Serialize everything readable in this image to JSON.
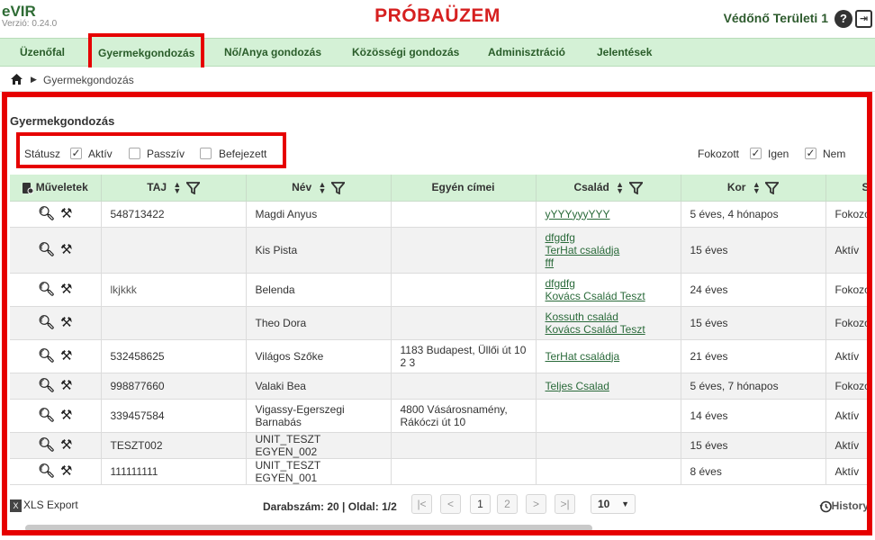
{
  "app": {
    "name": "eVIR",
    "version": "Verzió: 0.24.0",
    "environment": "PRÓBAÜZEM",
    "user": "Védőnő Területi 1"
  },
  "nav": {
    "items": [
      {
        "label": "Üzenőfal",
        "active": false
      },
      {
        "label": "Gyermekgondozás",
        "active": true
      },
      {
        "label": "Nő/Anya gondozás",
        "active": false
      },
      {
        "label": "Közösségi gondozás",
        "active": false
      },
      {
        "label": "Adminisztráció",
        "active": false
      },
      {
        "label": "Jelentések",
        "active": false
      }
    ]
  },
  "breadcrumb": {
    "current": "Gyermekgondozás"
  },
  "page": {
    "title": "Gyermekgondozás"
  },
  "filters": {
    "status_label": "Státusz",
    "status_options": [
      {
        "label": "Aktív",
        "checked": true
      },
      {
        "label": "Passzív",
        "checked": false
      },
      {
        "label": "Befejezett",
        "checked": false
      }
    ],
    "fokozott_label": "Fokozott",
    "fokozott_options": [
      {
        "label": "Igen",
        "checked": true
      },
      {
        "label": "Nem",
        "checked": true
      }
    ]
  },
  "table": {
    "columns": {
      "actions": "Műveletek",
      "taj": "TAJ",
      "nev": "Név",
      "cimek": "Egyén címei",
      "csalad": "Család",
      "kor": "Kor",
      "status": "S"
    },
    "rows": [
      {
        "taj": "548713422",
        "nev": "Magdi Anyus",
        "cim": "",
        "csalad": [
          "yYYYyyyYYY"
        ],
        "kor": "5 éves, 4 hónapos",
        "status": "Fokozo"
      },
      {
        "taj": "",
        "nev": "Kis Pista",
        "cim": "",
        "csalad": [
          "dfgdfg",
          "TerHat családja",
          "fff"
        ],
        "kor": "15 éves",
        "status": "Aktív"
      },
      {
        "taj": "lkjkkk",
        "nev": "Belenda",
        "cim": "",
        "csalad": [
          "dfgdfg",
          "Kovács Család Teszt"
        ],
        "kor": "24 éves",
        "status": "Fokozo"
      },
      {
        "taj": "",
        "nev": "Theo Dora",
        "cim": "",
        "csalad": [
          "Kossuth család",
          "Kovács Család Teszt"
        ],
        "kor": "15 éves",
        "status": "Fokozo"
      },
      {
        "taj": "532458625",
        "nev": "Világos Szőke",
        "cim": "1183 Budapest, Üllői út 10 2 3",
        "csalad": [
          "TerHat családja"
        ],
        "kor": "21 éves",
        "status": "Aktív"
      },
      {
        "taj": "998877660",
        "nev": "Valaki Bea",
        "cim": "",
        "csalad": [
          "Teljes Csalad"
        ],
        "kor": "5 éves, 7 hónapos",
        "status": "Fokozo"
      },
      {
        "taj": "339457584",
        "nev": "Vigassy-Egerszegi Barnabás",
        "cim": "4800 Vásárosnamény, Rákóczi út 10",
        "csalad": [],
        "kor": "14 éves",
        "status": "Aktív"
      },
      {
        "taj": "TESZT002",
        "nev": "UNIT_TESZT EGYEN_002",
        "cim": "",
        "csalad": [],
        "kor": "15 éves",
        "status": "Aktív"
      },
      {
        "taj": "111111111",
        "nev": "UNIT_TESZT EGYEN_001",
        "cim": "",
        "csalad": [],
        "kor": "8 éves",
        "status": "Aktív"
      }
    ]
  },
  "footer": {
    "xls_export": "XLS Export",
    "counts": "Darabszám: 20 | Oldal: 1/2",
    "pages": [
      "1",
      "2"
    ],
    "current_page": "1",
    "page_size": "10",
    "history": "History"
  },
  "icons": {
    "home": "home-icon",
    "search": "search-icon",
    "tools": "tools-icon",
    "sort": "sort-icon",
    "filter": "filter-icon",
    "help": "help-icon",
    "logout": "logout-icon",
    "export": "xls-icon",
    "history": "history-icon"
  },
  "colors": {
    "brand_green": "#2e6b34",
    "nav_bg": "#d4f1d6",
    "highlight_red": "#e60000",
    "env_red": "#d62020",
    "link_green": "#2a6a3a"
  }
}
